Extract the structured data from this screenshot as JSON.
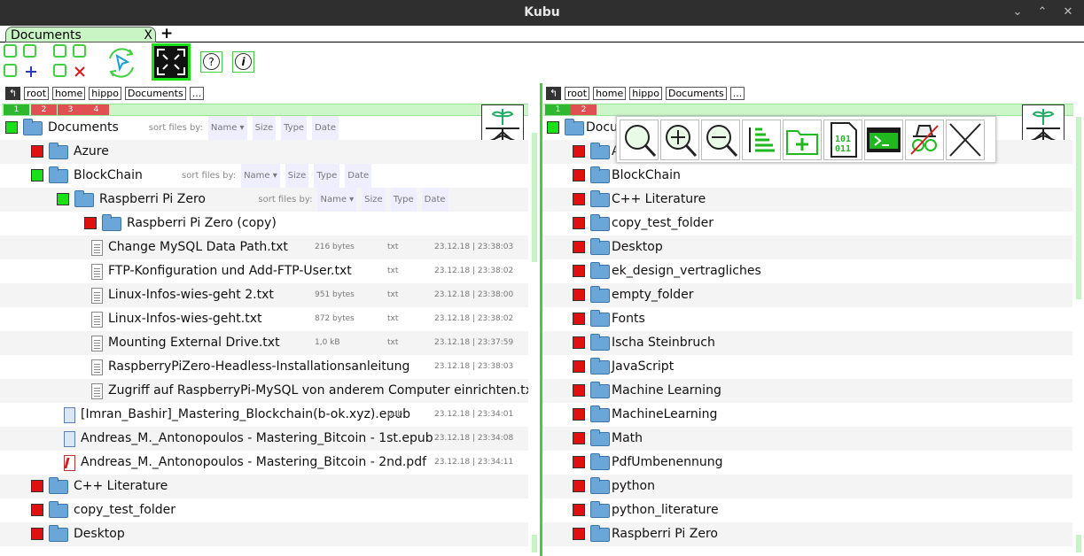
{
  "window": {
    "title": "Kubu",
    "minimize": "⌄",
    "maximize": "⌃",
    "close": "✕"
  },
  "tabs": [
    {
      "label": "Documents",
      "close": "X"
    }
  ],
  "add_tab": "+",
  "help_label": "?",
  "info_label": "i",
  "left_path": {
    "back": "↰",
    "crumbs": [
      "root",
      "home",
      "hippo",
      "Documents",
      "..."
    ]
  },
  "right_path": {
    "back": "↰",
    "crumbs": [
      "root",
      "home",
      "hippo",
      "Documents",
      "..."
    ]
  },
  "left_levels": [
    "1",
    "2",
    "3",
    "4"
  ],
  "right_levels": [
    "1",
    "2"
  ],
  "sort": {
    "label": "sort files by:",
    "name": "Name ▾",
    "size": "Size",
    "type": "Type",
    "date": "Date"
  },
  "left_rows": [
    {
      "kind": "folder",
      "dot": "g",
      "indent": 0,
      "label": "Documents",
      "sort": true
    },
    {
      "kind": "folder",
      "dot": "r",
      "indent": 1,
      "label": "Azure"
    },
    {
      "kind": "folder",
      "dot": "g",
      "indent": 1,
      "label": "BlockChain",
      "sort": true
    },
    {
      "kind": "folder",
      "dot": "g",
      "indent": 2,
      "label": "Raspberri Pi Zero",
      "sort": true
    },
    {
      "kind": "folder",
      "dot": "r",
      "indent": 3,
      "label": "Raspberri Pi Zero (copy)"
    },
    {
      "kind": "file",
      "indent": 3,
      "label": "Change MySQL Data Path.txt",
      "size": "216 bytes",
      "type": "txt",
      "date": "23.12.18 | 23:38:03"
    },
    {
      "kind": "file",
      "indent": 3,
      "label": "FTP-Konfiguration und Add-FTP-User.txt",
      "size": "",
      "type": "txt",
      "date": "23.12.18 | 23:38:02"
    },
    {
      "kind": "file",
      "indent": 3,
      "label": "Linux-Infos-wies-geht 2.txt",
      "size": "951 bytes",
      "type": "txt",
      "date": "23.12.18 | 23:38:00"
    },
    {
      "kind": "file",
      "indent": 3,
      "label": "Linux-Infos-wies-geht.txt",
      "size": "872 bytes",
      "type": "txt",
      "date": "23.12.18 | 23:38:02"
    },
    {
      "kind": "file",
      "indent": 3,
      "label": "Mounting External Drive.txt",
      "size": "1,0 kB",
      "type": "txt",
      "date": "23.12.18 | 23:37:59"
    },
    {
      "kind": "file",
      "indent": 3,
      "label": "RaspberryPiZero-Headless-Installationsanleitung",
      "size": "",
      "type": "",
      "date": "23.12.18 | 23:38:03"
    },
    {
      "kind": "file",
      "indent": 3,
      "label": "Zugriff auf RaspberryPi-MySQL von anderem Computer einrichten.txt",
      "size": "",
      "type": "",
      "date": ""
    },
    {
      "kind": "epub",
      "indent": 2,
      "label": "[Imran_Bashir]_Mastering_Blockchain(b-ok.xyz).epub",
      "size": "",
      "type": "pub",
      "date": "23.12.18 | 23:34:01"
    },
    {
      "kind": "epub",
      "indent": 2,
      "label": "Andreas_M._Antonopoulos - Mastering_Bitcoin - 1st.epub",
      "size": "",
      "type": "",
      "date": "23.12.18 | 23:34:08"
    },
    {
      "kind": "pdf",
      "indent": 2,
      "label": "Andreas_M._Antonopoulos - Mastering_Bitcoin - 2nd.pdf",
      "size": "",
      "type": "",
      "date": "23.12.18 | 23:34:11"
    },
    {
      "kind": "folder",
      "dot": "r",
      "indent": 1,
      "label": "C++ Literature"
    },
    {
      "kind": "folder",
      "dot": "r",
      "indent": 1,
      "label": "copy_test_folder"
    },
    {
      "kind": "folder",
      "dot": "r",
      "indent": 1,
      "label": "Desktop"
    }
  ],
  "right_rows": [
    {
      "dot": "g",
      "indent": 0,
      "label": "Docum"
    },
    {
      "dot": "r",
      "indent": 1,
      "label": "A"
    },
    {
      "dot": "r",
      "indent": 1,
      "label": "BlockChain"
    },
    {
      "dot": "r",
      "indent": 1,
      "label": "C++ Literature"
    },
    {
      "dot": "r",
      "indent": 1,
      "label": "copy_test_folder"
    },
    {
      "dot": "r",
      "indent": 1,
      "label": "Desktop"
    },
    {
      "dot": "r",
      "indent": 1,
      "label": "ek_design_vertragliches"
    },
    {
      "dot": "r",
      "indent": 1,
      "label": "empty_folder"
    },
    {
      "dot": "r",
      "indent": 1,
      "label": "Fonts"
    },
    {
      "dot": "r",
      "indent": 1,
      "label": "Ischa Steinbruch"
    },
    {
      "dot": "r",
      "indent": 1,
      "label": "JavaScript"
    },
    {
      "dot": "r",
      "indent": 1,
      "label": "Machine Learning"
    },
    {
      "dot": "r",
      "indent": 1,
      "label": "MachineLearning"
    },
    {
      "dot": "r",
      "indent": 1,
      "label": "Math"
    },
    {
      "dot": "r",
      "indent": 1,
      "label": "PdfUmbenennung"
    },
    {
      "dot": "r",
      "indent": 1,
      "label": "python"
    },
    {
      "dot": "r",
      "indent": 1,
      "label": "python_literature"
    },
    {
      "dot": "r",
      "indent": 1,
      "label": "Raspberri Pi Zero"
    }
  ],
  "popup_buttons": [
    {
      "name": "search-icon",
      "binary_label": ""
    },
    {
      "name": "zoom-in-icon",
      "binary_label": ""
    },
    {
      "name": "zoom-out-icon",
      "binary_label": ""
    },
    {
      "name": "sort-list-icon",
      "binary_label": ""
    },
    {
      "name": "new-folder-icon",
      "binary_label": ""
    },
    {
      "name": "binary-file-icon",
      "binary_label": "101\n011"
    },
    {
      "name": "terminal-icon",
      "binary_label": ""
    },
    {
      "name": "hidden-files-icon",
      "binary_label": ""
    },
    {
      "name": "close-popup-icon",
      "binary_label": ""
    }
  ],
  "colors": {
    "accent_green": "#3fcf3f",
    "folder_blue": "#6aa7d8",
    "dot_red": "#e01010",
    "dot_green": "#1ae01a"
  }
}
